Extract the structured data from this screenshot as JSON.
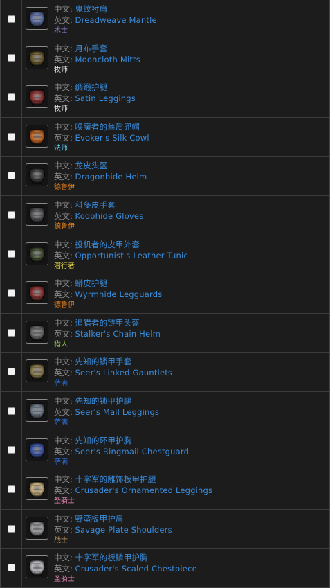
{
  "labels": {
    "cn": "中文: ",
    "en": "英文: "
  },
  "items": [
    {
      "cn": "鬼纹衬肩",
      "en": "Dreadweave Mantle",
      "cls": "术士",
      "cls_color": "#9a7fd6",
      "icon": "mantle-icon",
      "tint": "#5b6ea8"
    },
    {
      "cn": "月布手套",
      "en": "Mooncloth Mitts",
      "cls": "牧师",
      "cls_color": "#e8e8e8",
      "icon": "mitts-icon",
      "tint": "#6b5a2e"
    },
    {
      "cn": "绸缎护腿",
      "en": "Satin Leggings",
      "cls": "牧师",
      "cls_color": "#e8e8e8",
      "icon": "leggings-icon",
      "tint": "#8a2f2f"
    },
    {
      "cn": "唤魔者的丝质兜帽",
      "en": "Evoker's Silk Cowl",
      "cls": "法师",
      "cls_color": "#5cc3e6",
      "icon": "cowl-icon",
      "tint": "#c8641e"
    },
    {
      "cn": "龙皮头盔",
      "en": "Dragonhide Helm",
      "cls": "德鲁伊",
      "cls_color": "#e8801c",
      "icon": "helm-icon",
      "tint": "#3a3a3a"
    },
    {
      "cn": "科多皮手套",
      "en": "Kodohide Gloves",
      "cls": "德鲁伊",
      "cls_color": "#e8801c",
      "icon": "gloves-icon",
      "tint": "#55555a"
    },
    {
      "cn": "投机者的皮甲外套",
      "en": "Opportunist's Leather Tunic",
      "cls": "潜行者",
      "cls_color": "#f0e24a",
      "icon": "tunic-icon",
      "tint": "#3e4a2e"
    },
    {
      "cn": "蟒皮护腿",
      "en": "Wyrmhide Legguards",
      "cls": "德鲁伊",
      "cls_color": "#e8801c",
      "icon": "legguards-icon",
      "tint": "#8a3030"
    },
    {
      "cn": "追猎者的链甲头盔",
      "en": "Stalker's Chain Helm",
      "cls": "猎人",
      "cls_color": "#9bc94e",
      "icon": "chain-helm-icon",
      "tint": "#6a6a6a"
    },
    {
      "cn": "先知的鳞甲手套",
      "en": "Seer's Linked Gauntlets",
      "cls": "萨满",
      "cls_color": "#2f6fd6",
      "icon": "gauntlets-icon",
      "tint": "#8a7a4a"
    },
    {
      "cn": "先知的锁甲护腿",
      "en": "Seer's Mail Leggings",
      "cls": "萨满",
      "cls_color": "#2f6fd6",
      "icon": "mail-leggings-icon",
      "tint": "#6d7888"
    },
    {
      "cn": "先知的环甲护胸",
      "en": "Seer's Ringmail Chestguard",
      "cls": "萨满",
      "cls_color": "#2f6fd6",
      "icon": "chestguard-icon",
      "tint": "#3a55a8"
    },
    {
      "cn": "十字军的雕饰板甲护腿",
      "en": "Crusader's Ornamented Leggings",
      "cls": "圣骑士",
      "cls_color": "#e88ab6",
      "icon": "plate-leggings-icon",
      "tint": "#c8b07a"
    },
    {
      "cn": "野蛮板甲护肩",
      "en": "Savage Plate Shoulders",
      "cls": "战士",
      "cls_color": "#c89a68",
      "icon": "shoulders-icon",
      "tint": "#9a9aa0"
    },
    {
      "cn": "十字军的板鳞甲护胸",
      "en": "Crusader's Scaled Chestpiece",
      "cls": "圣骑士",
      "cls_color": "#e88ab6",
      "icon": "chestpiece-icon",
      "tint": "#b8b8c0"
    }
  ]
}
